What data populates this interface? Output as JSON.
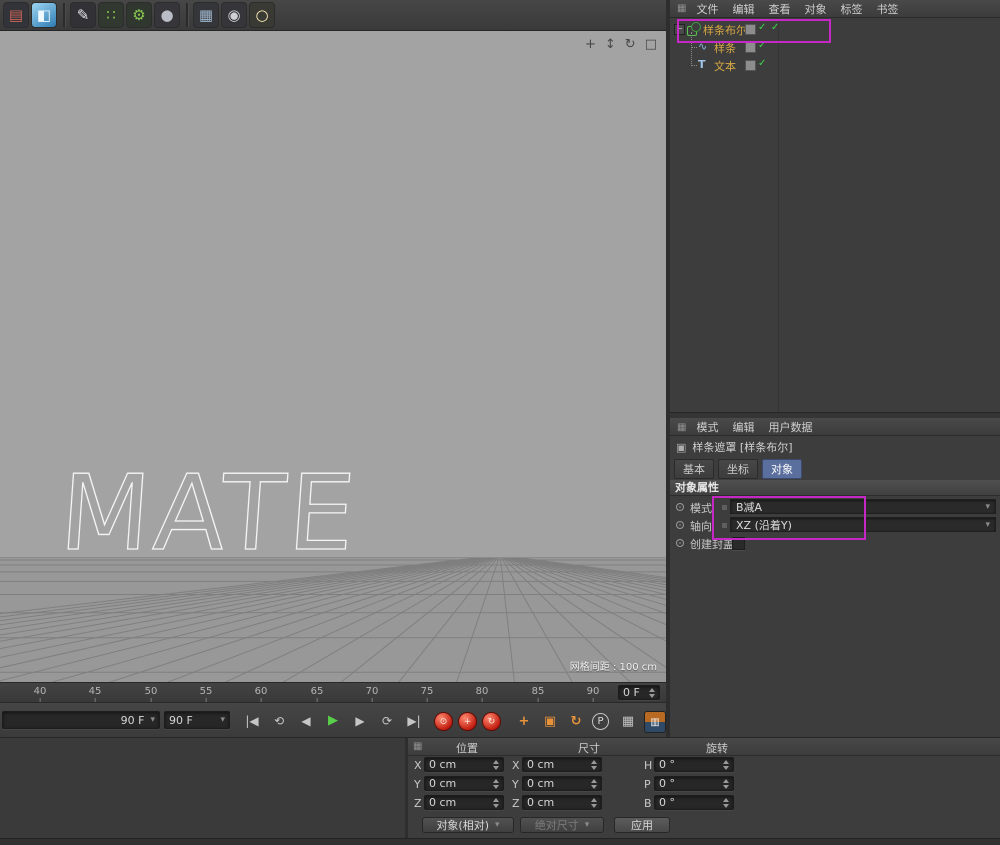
{
  "colors": {
    "annotation": "#c628c6",
    "enabled_check": "#3fd44a",
    "tree_label": "#d8a945",
    "active_tab": "#5b6f9f"
  },
  "top_toolbar": {
    "icons": [
      {
        "name": "render-settings-icon",
        "glyph": "▤"
      },
      {
        "name": "cube-primitive-icon",
        "glyph": "◧"
      },
      {
        "name": "pen-spline-icon",
        "glyph": "✎"
      },
      {
        "name": "array-generator-icon",
        "glyph": "∷"
      },
      {
        "name": "gear-deformer-icon",
        "glyph": "⚙"
      },
      {
        "name": "metaball-icon",
        "glyph": "●"
      },
      {
        "name": "floor-environment-icon",
        "glyph": "▦"
      },
      {
        "name": "camera-icon",
        "glyph": "◉"
      },
      {
        "name": "light-icon",
        "glyph": "○"
      }
    ]
  },
  "viewport": {
    "text_object": "MATE",
    "grid_label": "网格间距 : 100 cm",
    "nav_icons": [
      {
        "name": "pan-view-icon",
        "glyph": "+"
      },
      {
        "name": "zoom-view-icon",
        "glyph": "↕"
      },
      {
        "name": "rotate-view-icon",
        "glyph": "↻"
      },
      {
        "name": "toggle-view-icon",
        "glyph": "□"
      }
    ]
  },
  "timeline": {
    "ticks": [
      "40",
      "45",
      "50",
      "55",
      "60",
      "65",
      "70",
      "75",
      "80",
      "85",
      "90"
    ],
    "frame_field": "0 F"
  },
  "transport": {
    "range_start": "90 F",
    "range_end": "90 F",
    "buttons": [
      {
        "name": "goto-start-button",
        "glyph": "|◀"
      },
      {
        "name": "previous-key-button",
        "glyph": "⟲"
      },
      {
        "name": "previous-frame-button",
        "glyph": "◀"
      },
      {
        "name": "play-button",
        "glyph": "▶"
      },
      {
        "name": "next-frame-button",
        "glyph": "▶"
      },
      {
        "name": "next-key-button",
        "glyph": "⟳"
      },
      {
        "name": "goto-end-button",
        "glyph": "▶|"
      }
    ],
    "record_buttons": [
      {
        "name": "record-keyframe-button",
        "glyph": "⊙"
      },
      {
        "name": "autokey-position-button",
        "glyph": "+"
      },
      {
        "name": "autokey-rotation-button",
        "glyph": "↻"
      }
    ],
    "tool_buttons": [
      {
        "name": "move-tool-icon",
        "glyph": "+"
      },
      {
        "name": "scale-tool-icon",
        "glyph": "▣"
      },
      {
        "name": "rotate-tool-icon",
        "glyph": "↻"
      },
      {
        "name": "parameter-record-icon",
        "glyph": "P"
      },
      {
        "name": "keyframe-selection-icon",
        "glyph": "▦"
      },
      {
        "name": "layout-toggle-icon",
        "glyph": "▥"
      }
    ]
  },
  "right_panel": {
    "menu": [
      "文件",
      "编辑",
      "查看",
      "对象",
      "标签",
      "书签"
    ],
    "objects": [
      {
        "label": "样条布尔",
        "icon": "boolean-icon",
        "glyph": ""
      },
      {
        "label": "样条",
        "icon": "spline-icon",
        "glyph": "∿"
      },
      {
        "label": "文本",
        "icon": "text-spline-icon",
        "glyph": "T"
      }
    ]
  },
  "attributes": {
    "menu": [
      "模式",
      "编辑",
      "用户数据"
    ],
    "title": "样条遮罩 [样条布尔]",
    "tabs": [
      "基本",
      "坐标",
      "对象"
    ],
    "active_tab": "对象",
    "section": "对象属性",
    "rows": {
      "mode_label": "模式",
      "mode_value": "B减A",
      "axis_label": "轴向",
      "axis_value": "XZ  (沿着Y)",
      "cap_label": "创建封盖"
    }
  },
  "coordinates": {
    "groups": [
      {
        "title": "位置",
        "rows": [
          {
            "axis": "X",
            "value": "0 cm"
          },
          {
            "axis": "Y",
            "value": "0 cm"
          },
          {
            "axis": "Z",
            "value": "0 cm"
          }
        ]
      },
      {
        "title": "尺寸",
        "rows": [
          {
            "axis": "X",
            "value": "0 cm"
          },
          {
            "axis": "Y",
            "value": "0 cm"
          },
          {
            "axis": "Z",
            "value": "0 cm"
          }
        ]
      },
      {
        "title": "旋转",
        "rows": [
          {
            "axis": "H",
            "value": "0 °"
          },
          {
            "axis": "P",
            "value": "0 °"
          },
          {
            "axis": "B",
            "value": "0 °"
          }
        ]
      }
    ],
    "mode_button": "对象(相对)",
    "size_mode_button": "绝对尺寸",
    "apply_button": "应用"
  }
}
